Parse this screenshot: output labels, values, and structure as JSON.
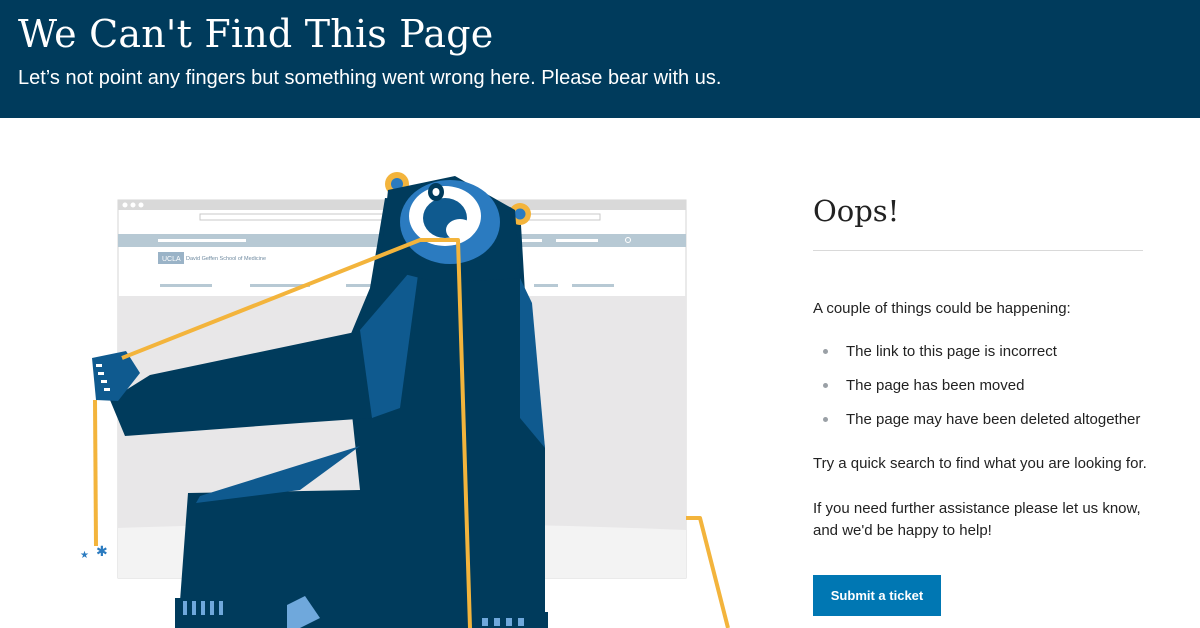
{
  "header": {
    "title": "We Can't Find This Page",
    "subtitle": "Let’s not point any fingers but something went wrong here. Please bear with us."
  },
  "illustration": {
    "browser_brand_badge": "UCLA",
    "browser_site_name": "David Geffen School of Medicine"
  },
  "sidebar": {
    "heading": "Oops!",
    "intro": "A couple of things could be happening:",
    "reasons": [
      "The link to this page is incorrect",
      "The page has been moved",
      "The page may have been deleted altogether"
    ],
    "search_hint": "Try a quick search to find what you are looking for.",
    "assist_text": "If you need further assistance please let us know, and we'd be happy to help!",
    "submit_label": "Submit a ticket"
  },
  "colors": {
    "banner": "#003b5c",
    "button": "#0077b3",
    "bear_dark": "#003b5c",
    "bear_mid": "#0f5a8f",
    "bear_light": "#2b7bc0",
    "cable": "#f3b43c"
  }
}
